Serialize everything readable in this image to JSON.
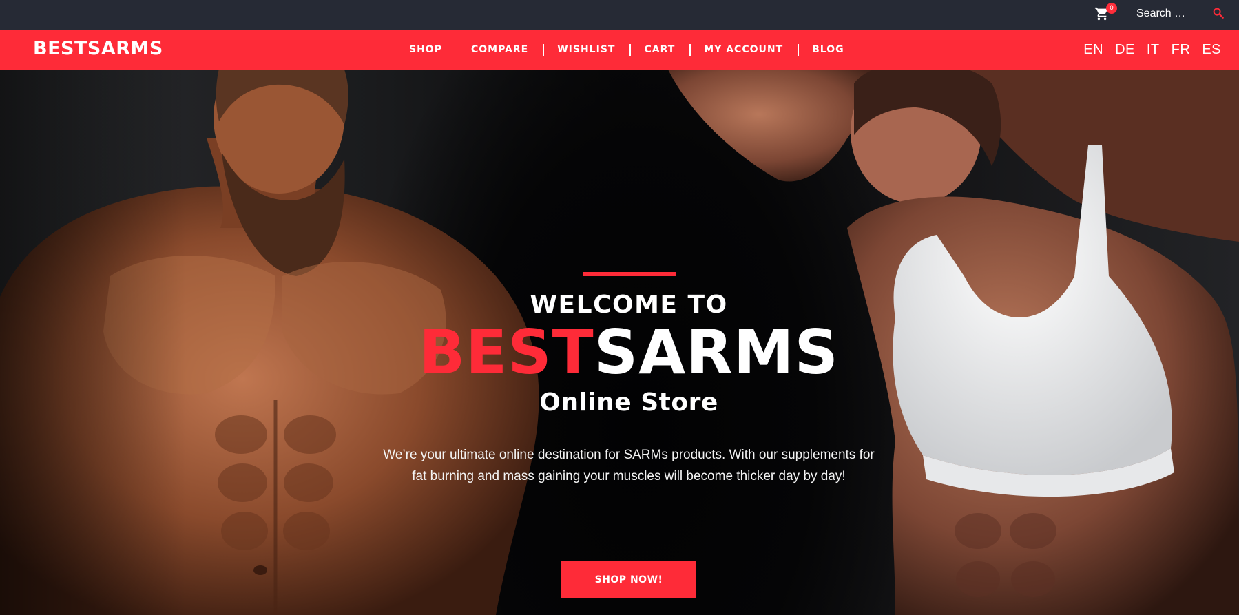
{
  "topbar": {
    "cart_count": "0",
    "search_placeholder": "Search …"
  },
  "navbar": {
    "logo": "BESTSARMS",
    "items": [
      "SHOP",
      "COMPARE",
      "WISHLIST",
      "CART",
      "MY ACCOUNT",
      "BLOG"
    ],
    "languages": [
      "EN",
      "DE",
      "IT",
      "FR",
      "ES"
    ]
  },
  "hero": {
    "welcome": "WELCOME TO",
    "brand_red": "BEST",
    "brand_white": "SARMS",
    "subtitle": "Online Store",
    "description": "We’re your ultimate online destination for SARMs products. With our supplements for fat burning and mass gaining your muscles will become thicker day by day!",
    "cta": "SHOP NOW!"
  },
  "colors": {
    "accent": "#fe2b38",
    "topbar_bg": "#262a35"
  },
  "icons": {
    "cart": "cart-icon",
    "search": "search-icon"
  }
}
